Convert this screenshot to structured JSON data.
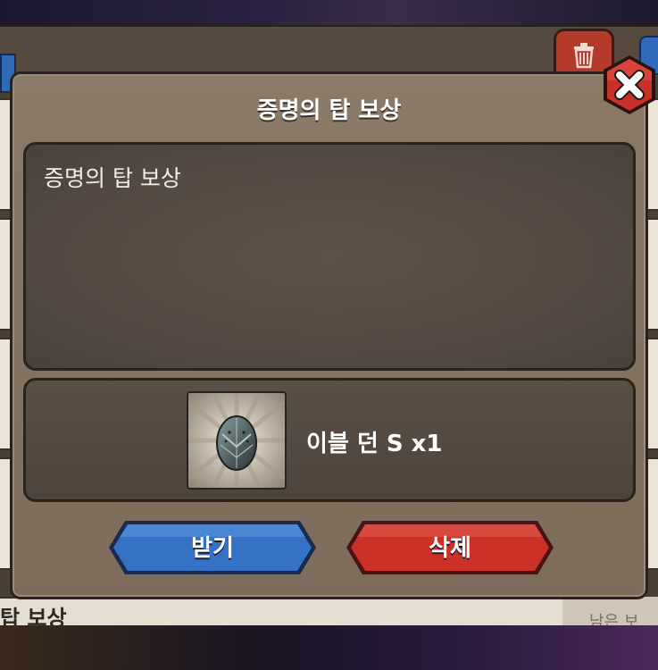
{
  "background": {
    "bottom_row_left_text": "탑 보상",
    "bottom_row_right_text": "남은 보"
  },
  "dialog": {
    "title": "증명의 탑 보상",
    "message": "증명의 탑 보상",
    "reward": {
      "icon": "egg-icon",
      "label": "이블 던 S x1"
    },
    "buttons": {
      "receive": "받기",
      "delete": "삭제"
    }
  },
  "colors": {
    "receive_button": "#2f6bc0",
    "delete_button": "#c8302a",
    "dialog_bg": "#84725f",
    "close_button": "#c8302a"
  }
}
